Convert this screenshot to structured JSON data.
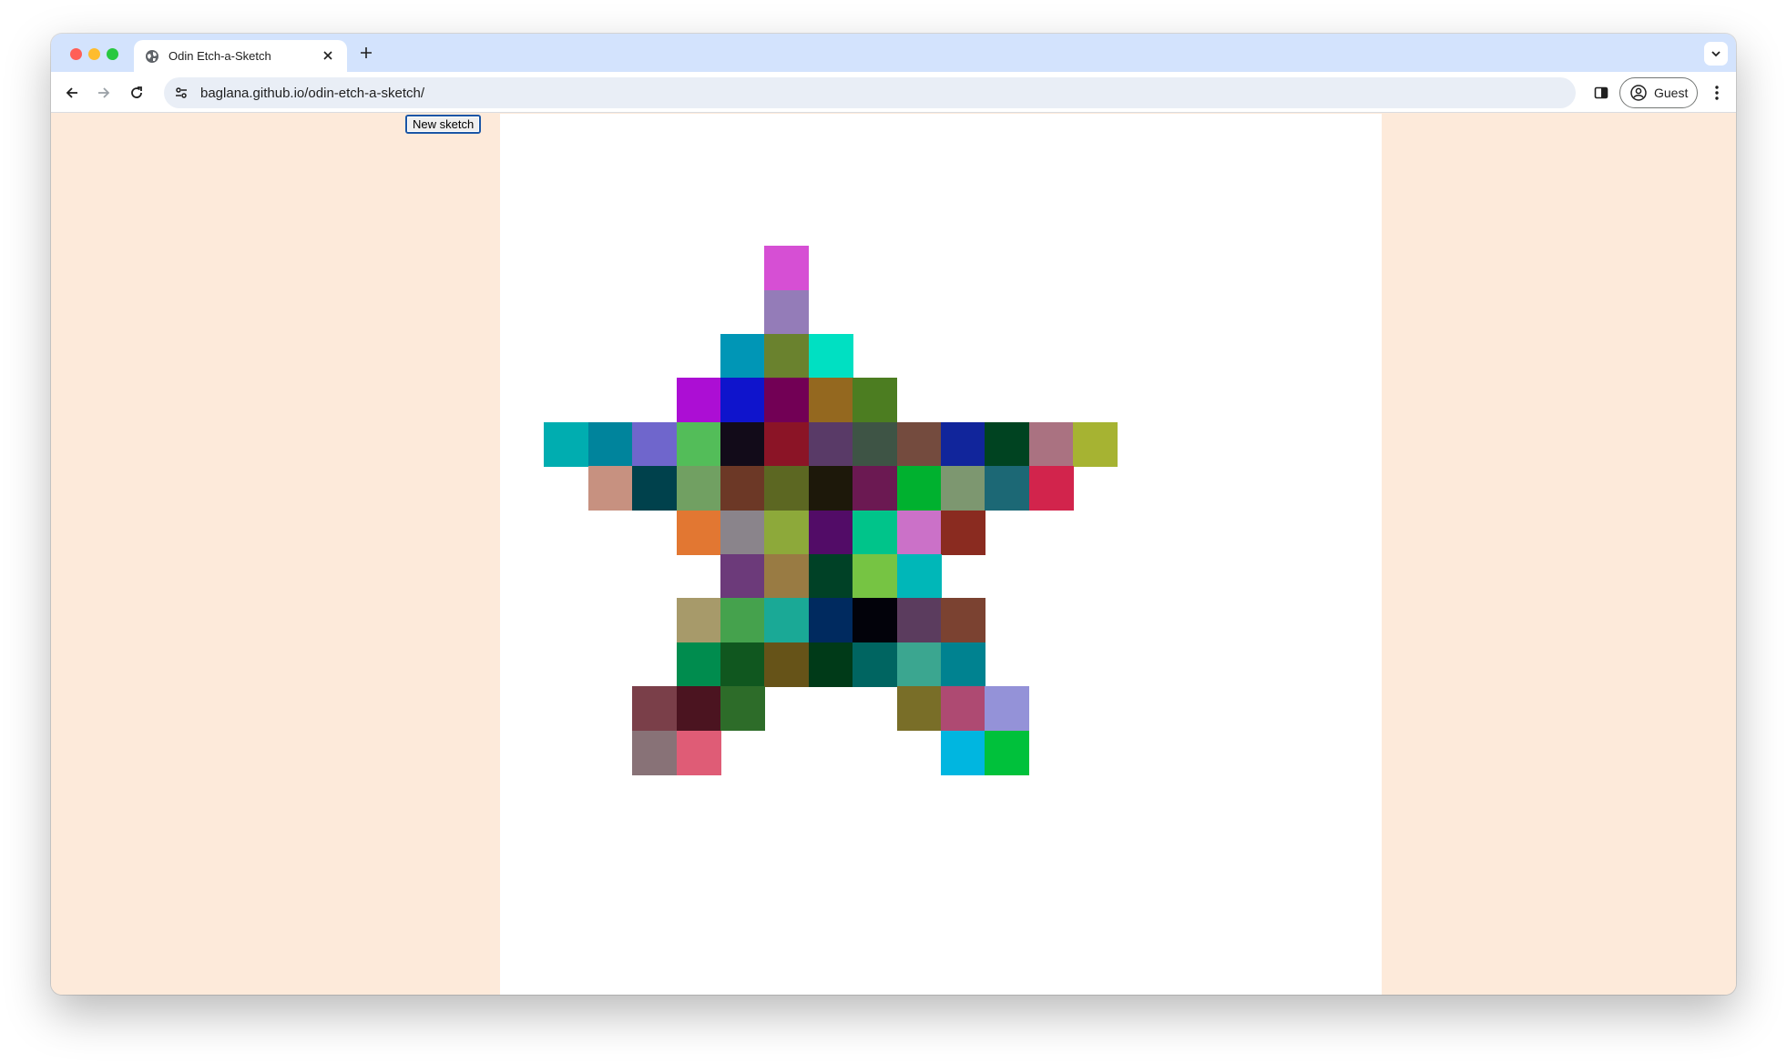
{
  "browser": {
    "tab_title": "Odin Etch-a-Sketch",
    "url": "baglana.github.io/odin-etch-a-sketch/",
    "profile_label": "Guest"
  },
  "page": {
    "button_label": "New sketch",
    "background_color": "#fdeada",
    "canvas_color": "#ffffff",
    "grid_size": 20,
    "painted_cells": [
      {
        "row": 3,
        "col": 6,
        "color": "#d64fd4"
      },
      {
        "row": 4,
        "col": 6,
        "color": "#947cb8"
      },
      {
        "row": 5,
        "col": 5,
        "color": "#0096b6"
      },
      {
        "row": 5,
        "col": 6,
        "color": "#6a822e"
      },
      {
        "row": 5,
        "col": 7,
        "color": "#00e0c2"
      },
      {
        "row": 6,
        "col": 4,
        "color": "#ac0ed4"
      },
      {
        "row": 6,
        "col": 5,
        "color": "#0f14cc"
      },
      {
        "row": 6,
        "col": 6,
        "color": "#720055"
      },
      {
        "row": 6,
        "col": 7,
        "color": "#94681f"
      },
      {
        "row": 6,
        "col": 8,
        "color": "#4c7d21"
      },
      {
        "row": 7,
        "col": 1,
        "color": "#00adb0"
      },
      {
        "row": 7,
        "col": 2,
        "color": "#00849c"
      },
      {
        "row": 7,
        "col": 3,
        "color": "#6f66cc"
      },
      {
        "row": 7,
        "col": 4,
        "color": "#53bd59"
      },
      {
        "row": 7,
        "col": 5,
        "color": "#120b19"
      },
      {
        "row": 7,
        "col": 6,
        "color": "#8b1426"
      },
      {
        "row": 7,
        "col": 7,
        "color": "#593a67"
      },
      {
        "row": 7,
        "col": 8,
        "color": "#3e5445"
      },
      {
        "row": 7,
        "col": 9,
        "color": "#744b3e"
      },
      {
        "row": 7,
        "col": 10,
        "color": "#11259b"
      },
      {
        "row": 7,
        "col": 11,
        "color": "#004321"
      },
      {
        "row": 7,
        "col": 12,
        "color": "#aa7281"
      },
      {
        "row": 7,
        "col": 13,
        "color": "#a6b332"
      },
      {
        "row": 8,
        "col": 2,
        "color": "#c79180"
      },
      {
        "row": 8,
        "col": 3,
        "color": "#00414c"
      },
      {
        "row": 8,
        "col": 4,
        "color": "#71a062"
      },
      {
        "row": 8,
        "col": 5,
        "color": "#6c3826"
      },
      {
        "row": 8,
        "col": 6,
        "color": "#5c6722"
      },
      {
        "row": 8,
        "col": 7,
        "color": "#1d180a"
      },
      {
        "row": 8,
        "col": 8,
        "color": "#6b1952"
      },
      {
        "row": 8,
        "col": 9,
        "color": "#00b12f"
      },
      {
        "row": 8,
        "col": 10,
        "color": "#7d9770"
      },
      {
        "row": 8,
        "col": 11,
        "color": "#1c6875"
      },
      {
        "row": 8,
        "col": 12,
        "color": "#d2244c"
      },
      {
        "row": 9,
        "col": 4,
        "color": "#e27732"
      },
      {
        "row": 9,
        "col": 5,
        "color": "#8a848b"
      },
      {
        "row": 9,
        "col": 6,
        "color": "#8da93a"
      },
      {
        "row": 9,
        "col": 7,
        "color": "#520c67"
      },
      {
        "row": 9,
        "col": 8,
        "color": "#00c48a"
      },
      {
        "row": 9,
        "col": 9,
        "color": "#cb71c8"
      },
      {
        "row": 9,
        "col": 10,
        "color": "#8a2b20"
      },
      {
        "row": 10,
        "col": 5,
        "color": "#6c3a7a"
      },
      {
        "row": 10,
        "col": 6,
        "color": "#997b43"
      },
      {
        "row": 10,
        "col": 7,
        "color": "#004126"
      },
      {
        "row": 10,
        "col": 8,
        "color": "#76c443"
      },
      {
        "row": 10,
        "col": 9,
        "color": "#00b7b8"
      },
      {
        "row": 11,
        "col": 4,
        "color": "#a79a6a"
      },
      {
        "row": 11,
        "col": 5,
        "color": "#45a24d"
      },
      {
        "row": 11,
        "col": 6,
        "color": "#1aa996"
      },
      {
        "row": 11,
        "col": 7,
        "color": "#002a5f"
      },
      {
        "row": 11,
        "col": 8,
        "color": "#02020a"
      },
      {
        "row": 11,
        "col": 9,
        "color": "#5b3c5e"
      },
      {
        "row": 11,
        "col": 10,
        "color": "#7b4231"
      },
      {
        "row": 12,
        "col": 4,
        "color": "#008c4e"
      },
      {
        "row": 12,
        "col": 5,
        "color": "#10571f"
      },
      {
        "row": 12,
        "col": 6,
        "color": "#665318"
      },
      {
        "row": 12,
        "col": 7,
        "color": "#003a18"
      },
      {
        "row": 12,
        "col": 8,
        "color": "#006561"
      },
      {
        "row": 12,
        "col": 9,
        "color": "#3ba690"
      },
      {
        "row": 12,
        "col": 10,
        "color": "#008290"
      },
      {
        "row": 13,
        "col": 3,
        "color": "#7a3f49"
      },
      {
        "row": 13,
        "col": 4,
        "color": "#4b1420"
      },
      {
        "row": 13,
        "col": 5,
        "color": "#2d6c29"
      },
      {
        "row": 13,
        "col": 9,
        "color": "#796e28"
      },
      {
        "row": 13,
        "col": 10,
        "color": "#ae4a72"
      },
      {
        "row": 13,
        "col": 11,
        "color": "#9492d8"
      },
      {
        "row": 14,
        "col": 3,
        "color": "#887277"
      },
      {
        "row": 14,
        "col": 4,
        "color": "#df5c76"
      },
      {
        "row": 14,
        "col": 10,
        "color": "#00b6e0"
      },
      {
        "row": 14,
        "col": 11,
        "color": "#00c13b"
      }
    ]
  },
  "icons": {
    "favicon": "globe-icon",
    "close": "close-icon",
    "new_tab": "plus-icon",
    "tab_search": "chevron-down-icon",
    "back": "back-arrow-icon",
    "forward": "forward-arrow-icon",
    "reload": "reload-icon",
    "site_info": "tune-icon",
    "side_panel": "side-panel-icon",
    "profile": "profile-icon",
    "menu": "kebab-menu-icon"
  }
}
